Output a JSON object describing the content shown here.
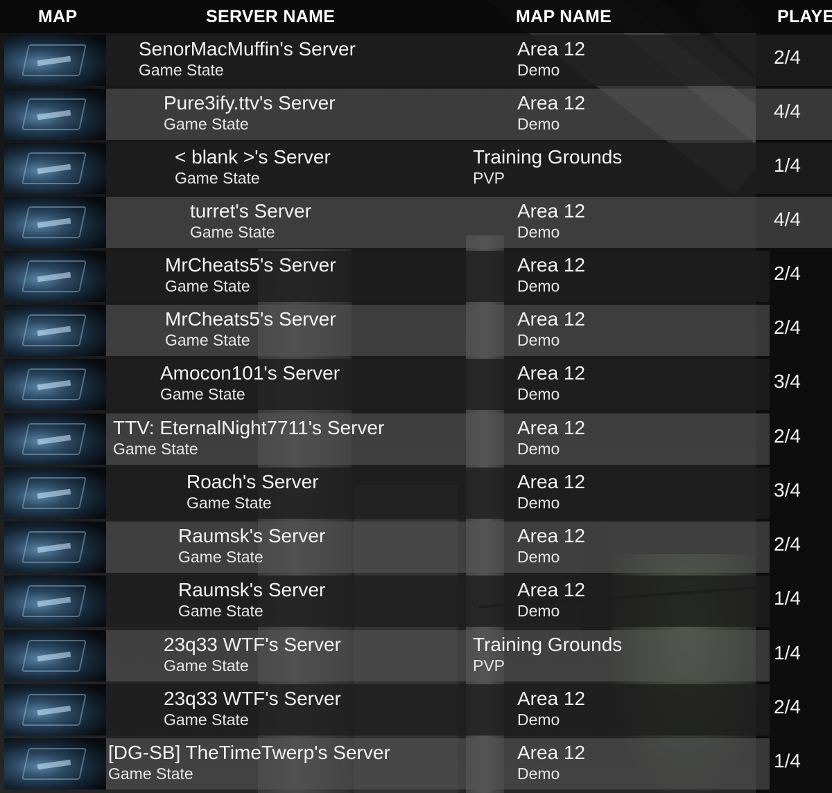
{
  "headers": {
    "map": "MAP",
    "server_name": "SERVER NAME",
    "map_name": "MAP NAME",
    "players": "PLAYER"
  },
  "rows": [
    {
      "name": "SenorMacMuffin's Server",
      "state": "Game State",
      "map": "Area 12",
      "mode": "Demo",
      "players": "2/4"
    },
    {
      "name": "Pure3ify.ttv's Server",
      "state": "Game State",
      "map": "Area 12",
      "mode": "Demo",
      "players": "4/4"
    },
    {
      "name": "< blank >'s Server",
      "state": "Game State",
      "map": "Training Grounds",
      "mode": "PVP",
      "players": "1/4"
    },
    {
      "name": "turret's Server",
      "state": "Game State",
      "map": "Area 12",
      "mode": "Demo",
      "players": "4/4"
    },
    {
      "name": "MrCheats5's Server",
      "state": "Game State",
      "map": "Area 12",
      "mode": "Demo",
      "players": "2/4"
    },
    {
      "name": "MrCheats5's Server",
      "state": "Game State",
      "map": "Area 12",
      "mode": "Demo",
      "players": "2/4"
    },
    {
      "name": "Amocon101's Server",
      "state": "Game State",
      "map": "Area 12",
      "mode": "Demo",
      "players": "3/4"
    },
    {
      "name": "TTV: EternalNight7711's Server",
      "state": "Game State",
      "map": "Area 12",
      "mode": "Demo",
      "players": "2/4"
    },
    {
      "name": "Roach's Server",
      "state": "Game State",
      "map": "Area 12",
      "mode": "Demo",
      "players": "3/4"
    },
    {
      "name": "Raumsk's Server",
      "state": "Game State",
      "map": "Area 12",
      "mode": "Demo",
      "players": "2/4"
    },
    {
      "name": "Raumsk's Server",
      "state": "Game State",
      "map": "Area 12",
      "mode": "Demo",
      "players": "1/4"
    },
    {
      "name": "23q33 WTF's Server",
      "state": "Game State",
      "map": "Training Grounds",
      "mode": "PVP",
      "players": "1/4"
    },
    {
      "name": "23q33 WTF's Server",
      "state": "Game State",
      "map": "Area 12",
      "mode": "Demo",
      "players": "2/4"
    },
    {
      "name": "[DG-SB] TheTimeTwerp's Server",
      "state": "Game State",
      "map": "Area 12",
      "mode": "Demo",
      "players": "1/4"
    }
  ]
}
